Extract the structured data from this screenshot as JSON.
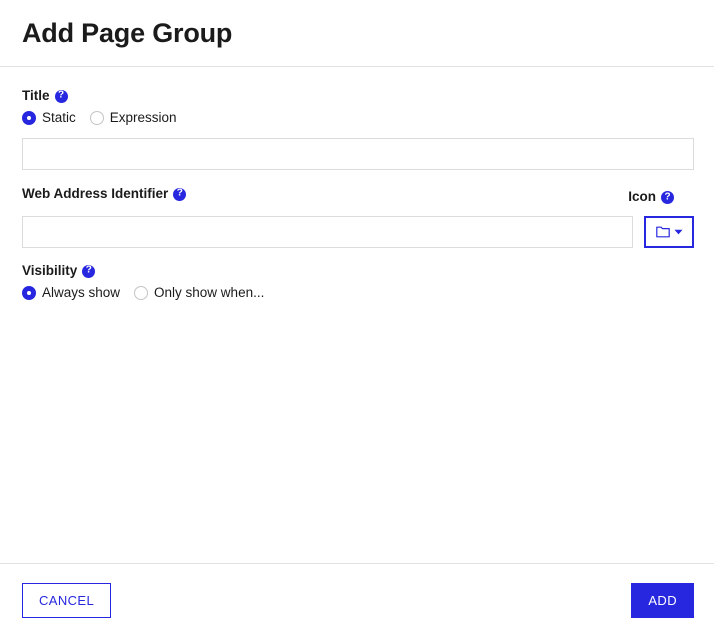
{
  "dialog": {
    "title": "Add Page Group"
  },
  "fields": {
    "title": {
      "label": "Title",
      "help_icon": "help-icon",
      "help_glyph": "?",
      "options": [
        {
          "label": "Static",
          "selected": true
        },
        {
          "label": "Expression",
          "selected": false
        }
      ],
      "value": "",
      "placeholder": ""
    },
    "web_address_identifier": {
      "label": "Web Address Identifier",
      "help_glyph": "?",
      "value": "",
      "placeholder": ""
    },
    "icon": {
      "label": "Icon",
      "help_glyph": "?",
      "selected_icon": "folder-icon",
      "caret_icon": "caret-down-icon"
    },
    "visibility": {
      "label": "Visibility",
      "help_glyph": "?",
      "options": [
        {
          "label": "Always show",
          "selected": true
        },
        {
          "label": "Only show when...",
          "selected": false
        }
      ]
    }
  },
  "footer": {
    "cancel_label": "CANCEL",
    "add_label": "ADD"
  },
  "colors": {
    "accent": "#2727e0",
    "border": "#dcdcdc",
    "divider": "#e2e2e2",
    "text": "#1b1b1b"
  }
}
